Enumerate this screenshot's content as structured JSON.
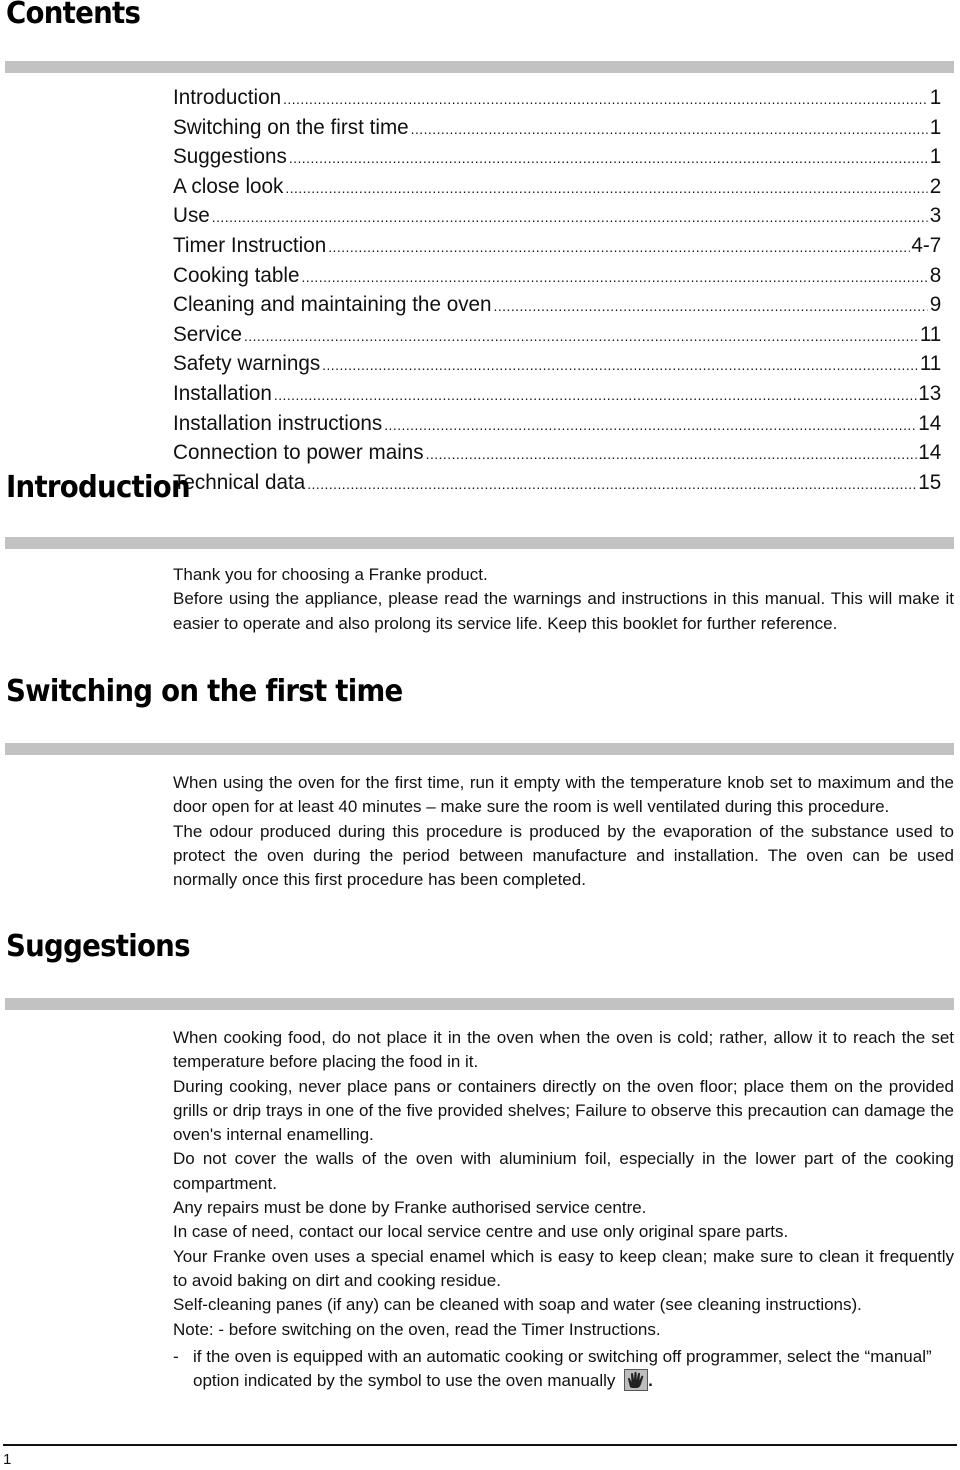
{
  "sections": {
    "contents": {
      "heading": "Contents",
      "toc": [
        {
          "label": "Introduction",
          "page": "1"
        },
        {
          "label": "Switching on the first time",
          "page": "1"
        },
        {
          "label": "Suggestions",
          "page": "1"
        },
        {
          "label": "A close look",
          "page": "2"
        },
        {
          "label": "Use",
          "page": "3"
        },
        {
          "label": "Timer Instruction",
          "page": "4-7"
        },
        {
          "label": "Cooking table",
          "page": "8"
        },
        {
          "label": "Cleaning and maintaining the oven",
          "page": "9"
        },
        {
          "label": "Service",
          "page": "11"
        },
        {
          "label": "Safety warnings",
          "page": "11"
        },
        {
          "label": "Installation",
          "page": "13"
        },
        {
          "label": "Installation instructions",
          "page": "14"
        },
        {
          "label": "Connection to power mains",
          "page": "14"
        },
        {
          "label": "Technical data",
          "page": "15"
        }
      ]
    },
    "introduction": {
      "heading": "Introduction",
      "paragraphs": [
        "Thank you for choosing a Franke product.",
        "Before using the appliance, please read the warnings and instructions in this manual. This will make it easier to operate and also prolong its service life. Keep this booklet for further reference."
      ]
    },
    "switching_on": {
      "heading": "Switching on the first time",
      "paragraphs": [
        "When using the oven for the first time, run it empty with the temperature knob set to maximum and the door open for at least 40 minutes – make sure the room is well ventilated during this procedure.",
        "The odour produced during this procedure is produced by the evaporation of the substance used to protect the oven during the period between manufacture and installation. The oven can be used normally once this first procedure has been completed."
      ]
    },
    "suggestions": {
      "heading": "Suggestions",
      "paragraphs": [
        "When cooking food, do not place it in the oven when the oven is cold; rather, allow it to reach the set temperature before placing the food in it.",
        "During cooking, never place pans or containers directly on the oven floor; place them on the provided grills or drip trays in one of the five provided shelves; Failure to observe this precaution can damage the oven's internal enamelling.",
        "Do not cover the walls of the oven with aluminium foil, especially in the lower part of the cooking compartment.",
        "Any repairs must be done by Franke authorised service centre.",
        "In case of need, contact our local service centre and use only original spare parts.",
        "Your Franke oven uses a special enamel which is easy to keep clean; make sure to clean it frequently to avoid baking on dirt and cooking residue.",
        "Self-cleaning panes (if any) can be cleaned with soap and water (see cleaning instructions).",
        "Note: - before switching on the oven, read the Timer Instructions."
      ],
      "dash_item": {
        "dash": "-",
        "text": "if the oven is equipped with an automatic cooking or switching off programmer, select the “manual” option indicated by the  symbol  to use the oven manually",
        "icon": "manual-hand-icon",
        "trailing": "."
      }
    }
  },
  "footer": {
    "page_number": "1"
  }
}
